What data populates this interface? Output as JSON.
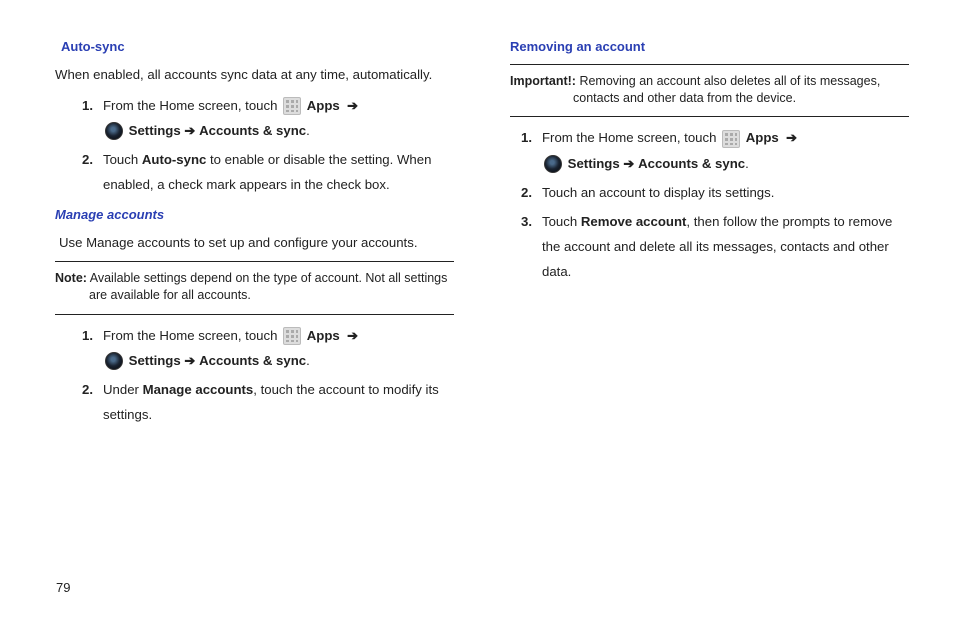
{
  "pageNumber": "79",
  "left": {
    "autoSync": {
      "heading": "Auto-sync",
      "intro": "When enabled, all accounts sync data at any time, automatically.",
      "step1a": "From the Home screen, touch ",
      "apps": "Apps",
      "arrow": "➔",
      "settings": "Settings",
      "accountsSync": "Accounts & sync",
      "step2a": "Touch ",
      "step2b": "Auto-sync",
      "step2c": " to enable or disable the setting. When enabled, a check mark appears in the check box."
    },
    "manage": {
      "heading": "Manage accounts",
      "intro": "Use Manage accounts to set up and configure your accounts.",
      "noteLabel": "Note:",
      "noteText": " Available settings depend on the type of account.  Not all settings are available for all accounts.",
      "step1a": "From the Home screen, touch ",
      "apps": "Apps",
      "arrow": "➔",
      "settings": "Settings",
      "accountsSync": "Accounts & sync",
      "step2a": "Under ",
      "step2b": "Manage accounts",
      "step2c": ", touch the account to modify its settings."
    }
  },
  "right": {
    "removing": {
      "heading": "Removing an account",
      "impLabel": "Important!:",
      "impText": " Removing an account also deletes all of its messages, contacts and other data from the device.",
      "step1a": "From the Home screen, touch ",
      "apps": "Apps",
      "arrow": "➔",
      "settings": "Settings",
      "accountsSync": "Accounts & sync",
      "step2": "Touch an account to display its settings.",
      "step3a": "Touch ",
      "step3b": "Remove account",
      "step3c": ", then follow the prompts to remove the account and delete all its messages, contacts and other data."
    }
  }
}
